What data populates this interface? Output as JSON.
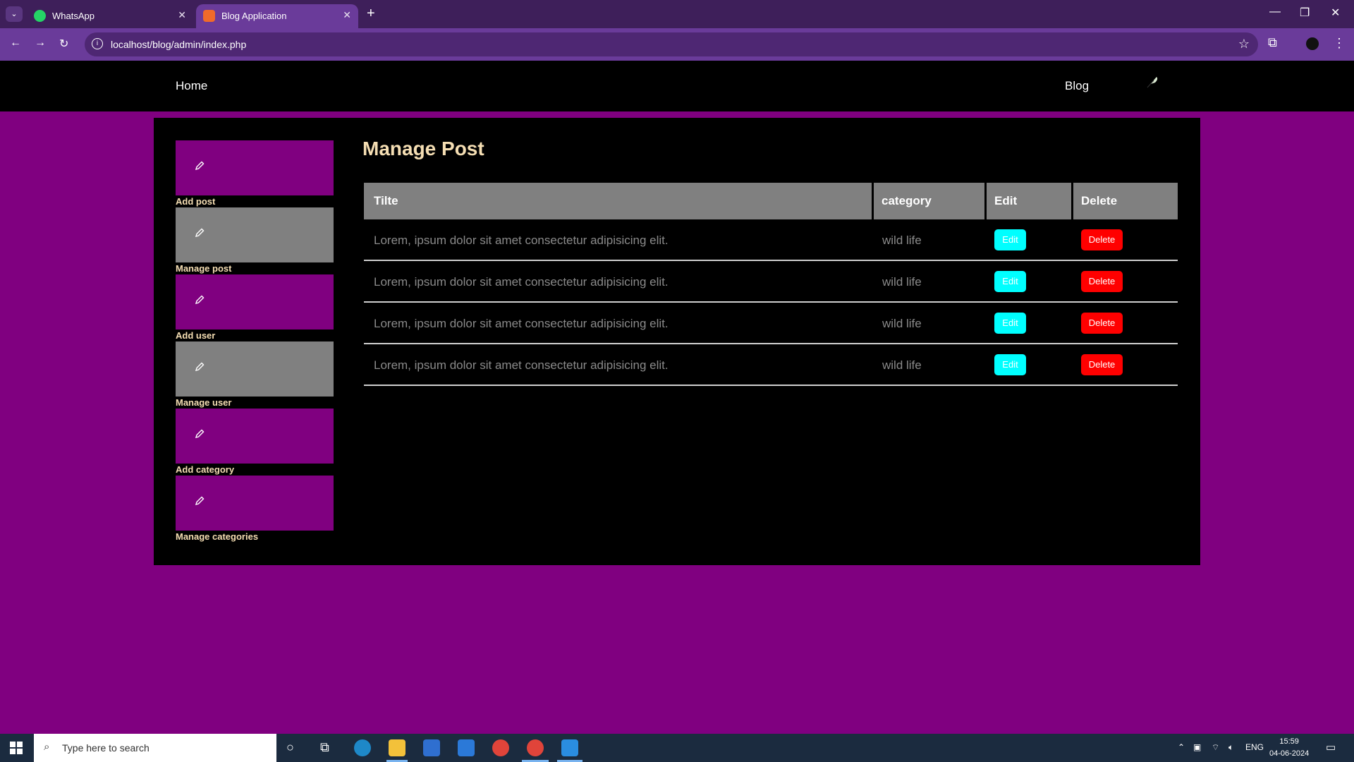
{
  "browser": {
    "tabs": [
      {
        "label": "WhatsApp",
        "icon": "whatsapp-icon"
      },
      {
        "label": "Blog Application",
        "icon": "blog-app-icon"
      }
    ],
    "url": "localhost/blog/admin/index.php"
  },
  "site_nav": {
    "home": "Home",
    "blog": "Blog"
  },
  "sidebar": {
    "items": [
      {
        "label": "Add post",
        "color": "#800080"
      },
      {
        "label": "Manage post",
        "color": "#808080"
      },
      {
        "label": "Add user",
        "color": "#800080"
      },
      {
        "label": "Manage user",
        "color": "#808080"
      },
      {
        "label": "Add category",
        "color": "#800080"
      },
      {
        "label": "Manage categories",
        "color": "#800080"
      }
    ]
  },
  "main": {
    "title": "Manage Post",
    "table": {
      "headers": [
        "Tilte",
        "category",
        "Edit",
        "Delete"
      ],
      "rows": [
        {
          "title": "Lorem, ipsum dolor sit amet consectetur adipisicing elit.",
          "category": "wild life",
          "edit": "Edit",
          "delete": "Delete"
        },
        {
          "title": "Lorem, ipsum dolor sit amet consectetur adipisicing elit.",
          "category": "wild life",
          "edit": "Edit",
          "delete": "Delete"
        },
        {
          "title": "Lorem, ipsum dolor sit amet consectetur adipisicing elit.",
          "category": "wild life",
          "edit": "Edit",
          "delete": "Delete"
        },
        {
          "title": "Lorem, ipsum dolor sit amet consectetur adipisicing elit.",
          "category": "wild life",
          "edit": "Edit",
          "delete": "Delete"
        }
      ]
    }
  },
  "taskbar": {
    "search_placeholder": "Type here to search",
    "language": "ENG",
    "time": "15:59",
    "date": "04-06-2024"
  },
  "colors": {
    "page_bg": "#800080",
    "heading": "#f5deb3",
    "edit_button": "#00ffff",
    "delete_button": "#ff0000"
  }
}
